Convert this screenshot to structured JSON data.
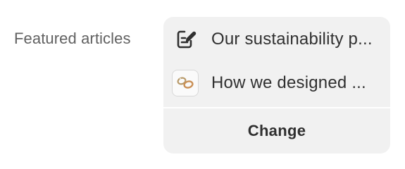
{
  "field": {
    "label": "Featured articles"
  },
  "articles": [
    {
      "title": "Our sustainability p...",
      "icon": "edit-note-icon"
    },
    {
      "title": "How we designed ...",
      "icon": "rings-thumbnail-image"
    }
  ],
  "actions": {
    "change_label": "Change"
  },
  "colors": {
    "card_background": "#f1f1f1",
    "text_primary": "#303030",
    "text_secondary": "#616161",
    "divider": "#ffffff"
  }
}
